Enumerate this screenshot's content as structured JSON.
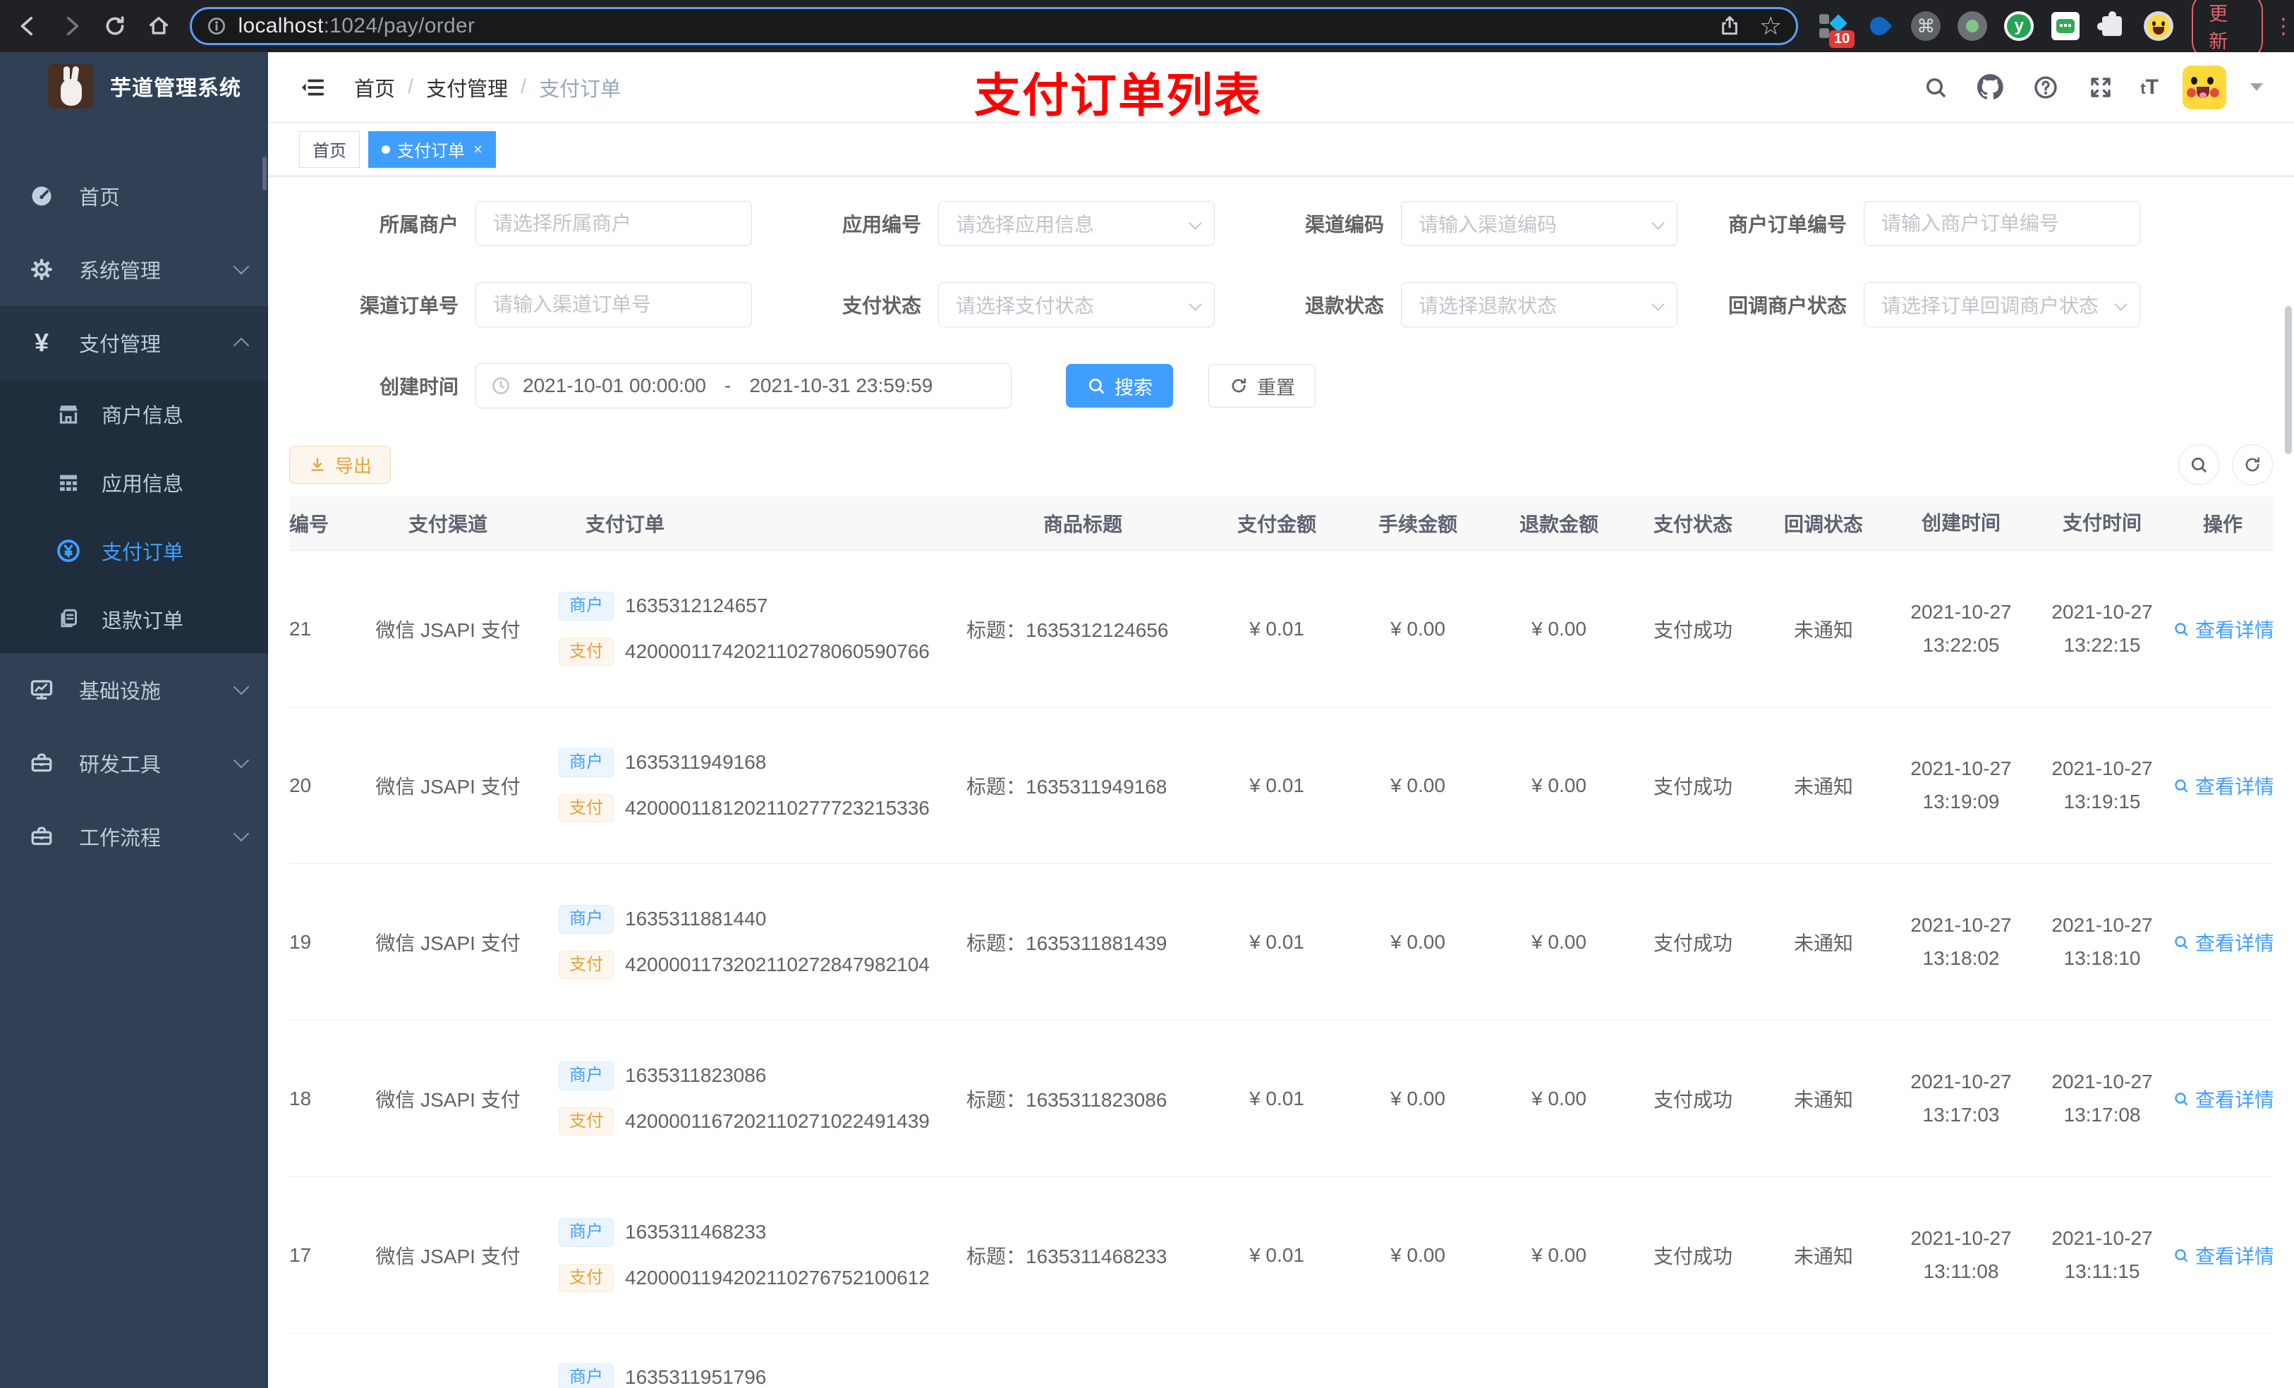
{
  "browser": {
    "url_host": "localhost",
    "url_rest": ":1024/pay/order",
    "extension_badge": "10",
    "update_label": "更新"
  },
  "sidebar": {
    "title": "芋道管理系统",
    "items": [
      {
        "label": "首页",
        "icon": "dashboard-icon"
      },
      {
        "label": "系统管理",
        "icon": "gear-icon"
      },
      {
        "label": "支付管理",
        "icon": "yen-icon"
      },
      {
        "label": "商户信息",
        "icon": "shop-icon"
      },
      {
        "label": "应用信息",
        "icon": "grid-icon"
      },
      {
        "label": "支付订单",
        "icon": "pay-circle-icon"
      },
      {
        "label": "退款订单",
        "icon": "document-icon"
      },
      {
        "label": "基础设施",
        "icon": "monitor-icon"
      },
      {
        "label": "研发工具",
        "icon": "toolbox-icon"
      },
      {
        "label": "工作流程",
        "icon": "briefcase-icon"
      }
    ],
    "yen_glyph": "¥"
  },
  "navbar": {
    "breadcrumb": [
      "首页",
      "支付管理",
      "支付订单"
    ],
    "annotation": "支付订单列表",
    "font_size_icon_text": "tT"
  },
  "tags_view": {
    "tabs": [
      {
        "label": "首页"
      },
      {
        "label": "支付订单",
        "close": "×"
      }
    ]
  },
  "filters": {
    "row1": [
      {
        "label": "所属商户",
        "placeholder": "请选择所属商户"
      },
      {
        "label": "应用编号",
        "placeholder": "请选择应用信息"
      },
      {
        "label": "渠道编码",
        "placeholder": "请输入渠道编码"
      },
      {
        "label": "商户订单编号",
        "placeholder": "请输入商户订单编号"
      }
    ],
    "row2": [
      {
        "label": "渠道订单号",
        "placeholder": "请输入渠道订单号"
      },
      {
        "label": "支付状态",
        "placeholder": "请选择支付状态"
      },
      {
        "label": "退款状态",
        "placeholder": "请选择退款状态"
      },
      {
        "label": "回调商户状态",
        "placeholder": "请选择订单回调商户状态"
      }
    ],
    "created_time": {
      "label": "创建时间",
      "start": "2021-10-01 00:00:00",
      "separator": "-",
      "end": "2021-10-31 23:59:59"
    },
    "search_label": "搜索",
    "reset_label": "重置"
  },
  "toolbar": {
    "export_label": "导出"
  },
  "table": {
    "columns": [
      "编号",
      "支付渠道",
      "支付订单",
      "商品标题",
      "支付金额",
      "手续金额",
      "退款金额",
      "支付状态",
      "回调状态",
      "创建时间",
      "支付时间",
      "操作"
    ],
    "merchant_tag": "商户",
    "pay_tag": "支付",
    "rows": [
      {
        "id": "21",
        "channel": "微信 JSAPI 支付",
        "merchant_no": "1635312124657",
        "channel_no": "4200001174202110278060590766",
        "title": "标题：1635312124656",
        "amount": "¥ 0.01",
        "fee": "¥ 0.00",
        "refund": "¥ 0.00",
        "status": "支付成功",
        "notify": "未通知",
        "create_date": "2021-10-27",
        "create_time": "13:22:05",
        "pay_date": "2021-10-27",
        "pay_time": "13:22:15",
        "action": "查看详情"
      },
      {
        "id": "20",
        "channel": "微信 JSAPI 支付",
        "merchant_no": "1635311949168",
        "channel_no": "4200001181202110277723215336",
        "title": "标题：1635311949168",
        "amount": "¥ 0.01",
        "fee": "¥ 0.00",
        "refund": "¥ 0.00",
        "status": "支付成功",
        "notify": "未通知",
        "create_date": "2021-10-27",
        "create_time": "13:19:09",
        "pay_date": "2021-10-27",
        "pay_time": "13:19:15",
        "action": "查看详情"
      },
      {
        "id": "19",
        "channel": "微信 JSAPI 支付",
        "merchant_no": "1635311881440",
        "channel_no": "4200001173202110272847982104",
        "title": "标题：1635311881439",
        "amount": "¥ 0.01",
        "fee": "¥ 0.00",
        "refund": "¥ 0.00",
        "status": "支付成功",
        "notify": "未通知",
        "create_date": "2021-10-27",
        "create_time": "13:18:02",
        "pay_date": "2021-10-27",
        "pay_time": "13:18:10",
        "action": "查看详情"
      },
      {
        "id": "18",
        "channel": "微信 JSAPI 支付",
        "merchant_no": "1635311823086",
        "channel_no": "4200001167202110271022491439",
        "title": "标题：1635311823086",
        "amount": "¥ 0.01",
        "fee": "¥ 0.00",
        "refund": "¥ 0.00",
        "status": "支付成功",
        "notify": "未通知",
        "create_date": "2021-10-27",
        "create_time": "13:17:03",
        "pay_date": "2021-10-27",
        "pay_time": "13:17:08",
        "action": "查看详情"
      },
      {
        "id": "17",
        "channel": "微信 JSAPI 支付",
        "merchant_no": "1635311468233",
        "channel_no": "4200001194202110276752100612",
        "title": "标题：1635311468233",
        "amount": "¥ 0.01",
        "fee": "¥ 0.00",
        "refund": "¥ 0.00",
        "status": "支付成功",
        "notify": "未通知",
        "create_date": "2021-10-27",
        "create_time": "13:11:08",
        "pay_date": "2021-10-27",
        "pay_time": "13:11:15",
        "action": "查看详情"
      }
    ],
    "partial_row": {
      "merchant_no": "1635311951796"
    }
  },
  "colors": {
    "accent": "#409eff",
    "sidebar_bg": "#304156",
    "submenu_bg": "#1f2d3d",
    "annotation_red": "#fe0000",
    "warning": "#e6a23c",
    "success_tag_blue_bg": "#ecf5ff",
    "pay_tag_orange_bg": "#fdf6ec"
  }
}
